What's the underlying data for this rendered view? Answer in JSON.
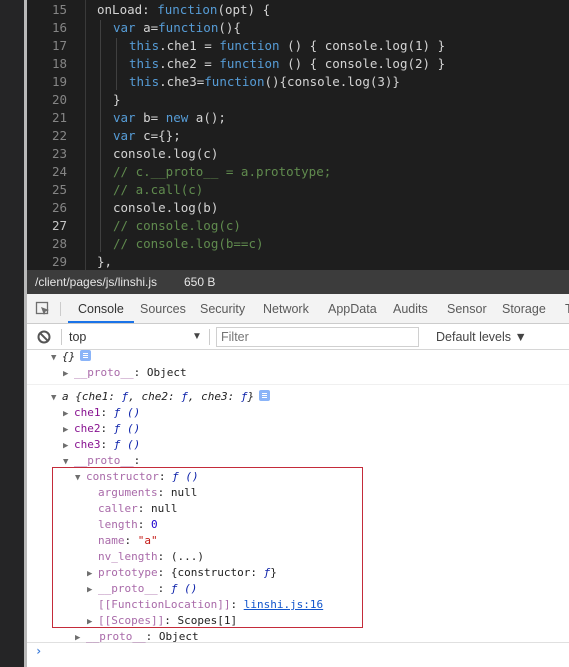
{
  "editor": {
    "active_line": 27,
    "lines": [
      {
        "n": "15",
        "indent": 0,
        "parts": [
          [
            "",
            "onLoad: "
          ],
          [
            "kw",
            "function"
          ],
          [
            "",
            "(opt) {"
          ]
        ]
      },
      {
        "n": "16",
        "indent": 1,
        "parts": [
          [
            "kw",
            "var"
          ],
          [
            "",
            " a="
          ],
          [
            "kw",
            "function"
          ],
          [
            "",
            "(){"
          ]
        ]
      },
      {
        "n": "17",
        "indent": 2,
        "parts": [
          [
            "kw",
            "this"
          ],
          [
            "",
            ".che1 = "
          ],
          [
            "kw",
            "function"
          ],
          [
            "",
            " () { console.log(1) }"
          ]
        ]
      },
      {
        "n": "18",
        "indent": 2,
        "parts": [
          [
            "kw",
            "this"
          ],
          [
            "",
            ".che2 = "
          ],
          [
            "kw",
            "function"
          ],
          [
            "",
            " () { console.log(2) }"
          ]
        ]
      },
      {
        "n": "19",
        "indent": 2,
        "parts": [
          [
            "kw",
            "this"
          ],
          [
            "",
            ".che3="
          ],
          [
            "kw",
            "function"
          ],
          [
            "",
            "(){console.log(3)}"
          ]
        ]
      },
      {
        "n": "20",
        "indent": 1,
        "parts": [
          [
            "",
            "}"
          ]
        ]
      },
      {
        "n": "21",
        "indent": 1,
        "parts": [
          [
            "kw",
            "var"
          ],
          [
            "",
            " b= "
          ],
          [
            "kw",
            "new"
          ],
          [
            "",
            " a();"
          ]
        ]
      },
      {
        "n": "22",
        "indent": 1,
        "parts": [
          [
            "kw",
            "var"
          ],
          [
            "",
            " c={};"
          ]
        ]
      },
      {
        "n": "23",
        "indent": 1,
        "parts": [
          [
            "",
            "console.log(c)"
          ]
        ]
      },
      {
        "n": "24",
        "indent": 1,
        "parts": [
          [
            "cm",
            "// c.__proto__ = a.prototype;"
          ]
        ]
      },
      {
        "n": "25",
        "indent": 1,
        "parts": [
          [
            "cm",
            "// a.call(c)"
          ]
        ]
      },
      {
        "n": "26",
        "indent": 1,
        "parts": [
          [
            "",
            "console.log(b)"
          ]
        ]
      },
      {
        "n": "27",
        "indent": 1,
        "parts": [
          [
            "cm",
            "// console.log(c)"
          ]
        ]
      },
      {
        "n": "28",
        "indent": 1,
        "parts": [
          [
            "cm",
            "// console.log(b==c)"
          ]
        ]
      },
      {
        "n": "29",
        "indent": 0,
        "parts": [
          [
            "",
            "},"
          ]
        ]
      }
    ]
  },
  "filebar": {
    "path": "/client/pages/js/linshi.js",
    "size": "650 B"
  },
  "devtools": {
    "tabs": [
      "Console",
      "Sources",
      "Security",
      "Network",
      "AppData",
      "Audits",
      "Sensor",
      "Storage",
      "T"
    ],
    "active_tab": "Console",
    "context": "top",
    "filter_placeholder": "Filter",
    "levels": "Default levels ▼"
  },
  "console": {
    "rows": [
      {
        "depth": 0,
        "tri": "▼",
        "segs": [
          [
            "ital",
            "{}"
          ]
        ],
        "badge": true
      },
      {
        "depth": 1,
        "tri": "▶",
        "segs": [
          [
            "prop-dim",
            "__proto__"
          ],
          [
            "",
            ": Object"
          ]
        ]
      },
      {
        "depth": 0,
        "tri": "▼",
        "segs": [
          [
            "ital",
            "a {che1: "
          ],
          [
            "fn",
            "ƒ"
          ],
          [
            "ital",
            ", che2: "
          ],
          [
            "fn",
            "ƒ"
          ],
          [
            "ital",
            ", che3: "
          ],
          [
            "fn",
            "ƒ"
          ],
          [
            "ital",
            "}"
          ]
        ],
        "badge": true
      },
      {
        "depth": 1,
        "tri": "▶",
        "segs": [
          [
            "prop-name",
            "che1"
          ],
          [
            "",
            ": "
          ],
          [
            "fn",
            "ƒ ()"
          ]
        ]
      },
      {
        "depth": 1,
        "tri": "▶",
        "segs": [
          [
            "prop-name",
            "che2"
          ],
          [
            "",
            ": "
          ],
          [
            "fn",
            "ƒ ()"
          ]
        ]
      },
      {
        "depth": 1,
        "tri": "▶",
        "segs": [
          [
            "prop-name",
            "che3"
          ],
          [
            "",
            ": "
          ],
          [
            "fn",
            "ƒ ()"
          ]
        ]
      },
      {
        "depth": 1,
        "tri": "▼",
        "segs": [
          [
            "prop-dim",
            "__proto__"
          ],
          [
            "",
            ":"
          ]
        ]
      },
      {
        "depth": 2,
        "tri": "▼",
        "segs": [
          [
            "prop-dim",
            "constructor"
          ],
          [
            "",
            ": "
          ],
          [
            "fn",
            "ƒ ()"
          ]
        ]
      },
      {
        "depth": 3,
        "tri": "",
        "segs": [
          [
            "prop-dim",
            "arguments"
          ],
          [
            "",
            ": null"
          ]
        ]
      },
      {
        "depth": 3,
        "tri": "",
        "segs": [
          [
            "prop-dim",
            "caller"
          ],
          [
            "",
            ": null"
          ]
        ]
      },
      {
        "depth": 3,
        "tri": "",
        "segs": [
          [
            "prop-dim",
            "length"
          ],
          [
            "",
            ": "
          ],
          [
            "num",
            "0"
          ]
        ]
      },
      {
        "depth": 3,
        "tri": "",
        "segs": [
          [
            "prop-dim",
            "name"
          ],
          [
            "",
            ": "
          ],
          [
            "str",
            "\"a\""
          ]
        ]
      },
      {
        "depth": 3,
        "tri": "",
        "segs": [
          [
            "prop-dim",
            "nv_length"
          ],
          [
            "",
            ": (...)"
          ]
        ]
      },
      {
        "depth": 3,
        "tri": "▶",
        "segs": [
          [
            "prop-dim",
            "prototype"
          ],
          [
            "",
            ": {constructor: "
          ],
          [
            "fn",
            "ƒ"
          ],
          [
            "",
            "}"
          ]
        ]
      },
      {
        "depth": 3,
        "tri": "▶",
        "segs": [
          [
            "prop-dim",
            "__proto__"
          ],
          [
            "",
            ": "
          ],
          [
            "fn",
            "ƒ ()"
          ]
        ]
      },
      {
        "depth": 3,
        "tri": "",
        "segs": [
          [
            "prop-dim",
            "[[FunctionLocation]]"
          ],
          [
            "",
            ": "
          ],
          [
            "link",
            "linshi.js:16"
          ]
        ]
      },
      {
        "depth": 3,
        "tri": "▶",
        "segs": [
          [
            "prop-dim",
            "[[Scopes]]"
          ],
          [
            "",
            ": Scopes[1]"
          ]
        ]
      },
      {
        "depth": 2,
        "tri": "▶",
        "segs": [
          [
            "prop-dim",
            "__proto__"
          ],
          [
            "",
            ": Object"
          ]
        ]
      }
    ],
    "prompt": "›"
  }
}
